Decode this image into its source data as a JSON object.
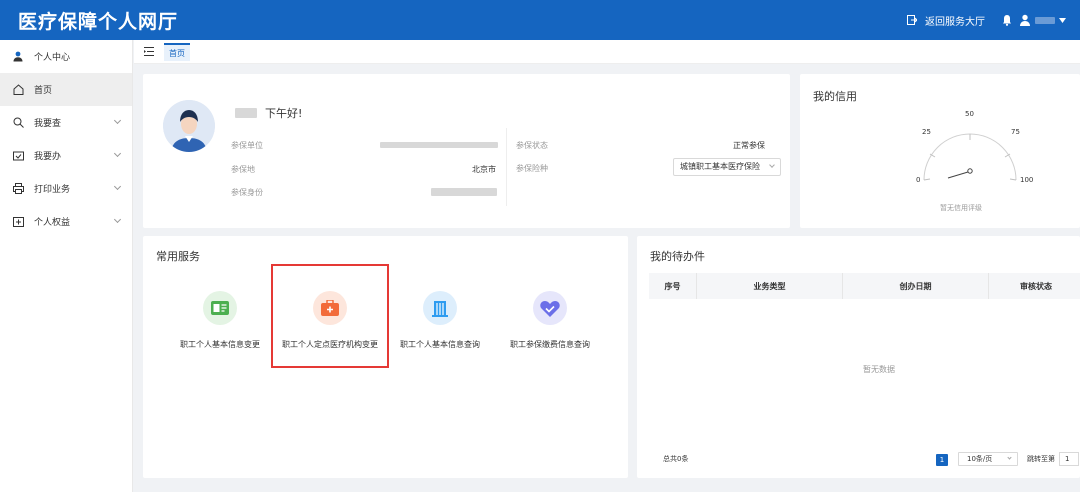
{
  "header": {
    "title": "医疗保障个人网厅",
    "return_label": "返回服务大厅",
    "icons": [
      "bell-icon",
      "user-icon",
      "caret-down-icon"
    ]
  },
  "sidebar": {
    "items": [
      {
        "label": "个人中心",
        "icon": "user-center-icon"
      },
      {
        "label": "首页",
        "icon": "home-icon"
      },
      {
        "label": "我要查",
        "icon": "search-icon"
      },
      {
        "label": "我要办",
        "icon": "handle-icon"
      },
      {
        "label": "打印业务",
        "icon": "printer-icon"
      },
      {
        "label": "个人权益",
        "icon": "rights-icon"
      }
    ]
  },
  "tabs": {
    "home": "首页"
  },
  "profile": {
    "greeting": "下午好!",
    "unit_label": "参保单位",
    "place_label": "参保地",
    "place_value": "北京市",
    "identity_label": "参保身份",
    "status_label": "参保状态",
    "status_value": "正常参保",
    "type_label": "参保险种",
    "type_value": "城镇职工基本医疗保险"
  },
  "credit": {
    "title": "我的信用",
    "ticks": [
      "0",
      "25",
      "50",
      "75",
      "100"
    ],
    "empty_text": "暂无信用评级"
  },
  "services": {
    "title": "常用服务",
    "items": [
      {
        "label": "职工个人基本信息变更",
        "icon": "id-card-icon",
        "color": "#4caf50",
        "bg": "#e4f4e4"
      },
      {
        "label": "职工个人定点医疗机构变更",
        "icon": "medical-kit-icon",
        "color": "#f26b3a",
        "bg": "#fde6dc"
      },
      {
        "label": "职工个人基本信息查询",
        "icon": "building-icon",
        "color": "#2e9cf0",
        "bg": "#ddeefc"
      },
      {
        "label": "职工参保缴费信息查询",
        "icon": "heart-check-icon",
        "color": "#6b6fe8",
        "bg": "#e6e6fb"
      }
    ]
  },
  "todo": {
    "title": "我的待办件",
    "columns": [
      "序号",
      "业务类型",
      "创办日期",
      "审核状态"
    ],
    "empty_text": "暂无数据",
    "total": "总共0条",
    "page": "1",
    "page_size": "10条/页",
    "jump_label": "跳转至第",
    "jump_value": "1"
  }
}
